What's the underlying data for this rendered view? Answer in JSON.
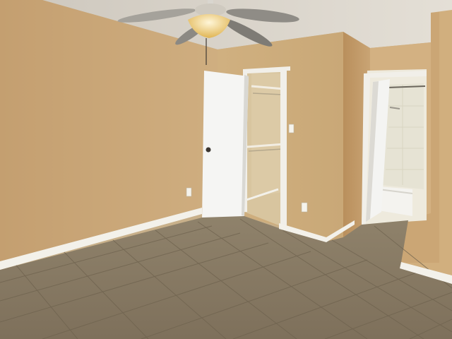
{
  "scene": {
    "kind": "empty bedroom interior photo",
    "colors": {
      "wall_main": "#c9a878",
      "wall_shadow": "#b99566",
      "wall_right": "#d2b27f",
      "ceiling": "#ded9cf",
      "floor": "#8a7c66",
      "floor_light": "#9c8e77",
      "grout": "#6f634f",
      "baseboard": "#f3f1ea",
      "door": "#f4f4f2",
      "closet_interior": "#d9c7a3",
      "bath_tile": "#e6e3d4"
    },
    "objects": [
      "ceiling-fan",
      "light-fixture",
      "closet-door",
      "walk-in-closet",
      "bathroom-door",
      "bathtub",
      "tile-floor",
      "baseboard",
      "wall-outlet"
    ]
  }
}
